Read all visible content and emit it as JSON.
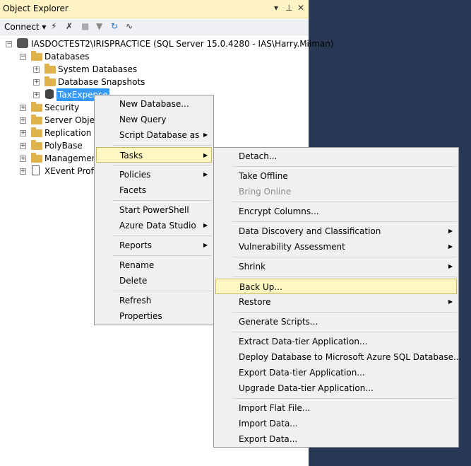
{
  "panel": {
    "title": "Object Explorer",
    "pin_glyph": "▾",
    "pin2": "⊣",
    "close_glyph": "✕"
  },
  "toolbar": {
    "connect_label": "Connect ▾"
  },
  "tree": {
    "root": "IASDOCTEST2\\IRISPRACTICE (SQL Server 15.0.4280 - IAS\\Harry.Milman)",
    "databases": "Databases",
    "system_databases": "System Databases",
    "database_snapshots": "Database Snapshots",
    "selected_db": "TaxExpense",
    "security": "Security",
    "server_objects": "Server Objects",
    "replication": "Replication",
    "polybase": "PolyBase",
    "management": "Management",
    "xevent": "XEvent Profiler"
  },
  "context_menu": {
    "new_database": "New Database...",
    "new_query": "New Query",
    "script_database_as": "Script Database as",
    "tasks": "Tasks",
    "policies": "Policies",
    "facets": "Facets",
    "start_powershell": "Start PowerShell",
    "azure_data_studio": "Azure Data Studio",
    "reports": "Reports",
    "rename": "Rename",
    "delete": "Delete",
    "refresh": "Refresh",
    "properties": "Properties"
  },
  "tasks_menu": {
    "detach": "Detach...",
    "take_offline": "Take Offline",
    "bring_online": "Bring Online",
    "encrypt_columns": "Encrypt Columns...",
    "data_discovery": "Data Discovery and Classification",
    "vulnerability": "Vulnerability Assessment",
    "shrink": "Shrink",
    "back_up": "Back Up...",
    "restore": "Restore",
    "generate_scripts": "Generate Scripts...",
    "extract_dac": "Extract Data-tier Application...",
    "deploy_azure": "Deploy Database to Microsoft Azure SQL Database...",
    "export_dac": "Export Data-tier Application...",
    "upgrade_dac": "Upgrade Data-tier Application...",
    "import_flat": "Import Flat File...",
    "import_data": "Import Data...",
    "export_data": "Export Data..."
  }
}
